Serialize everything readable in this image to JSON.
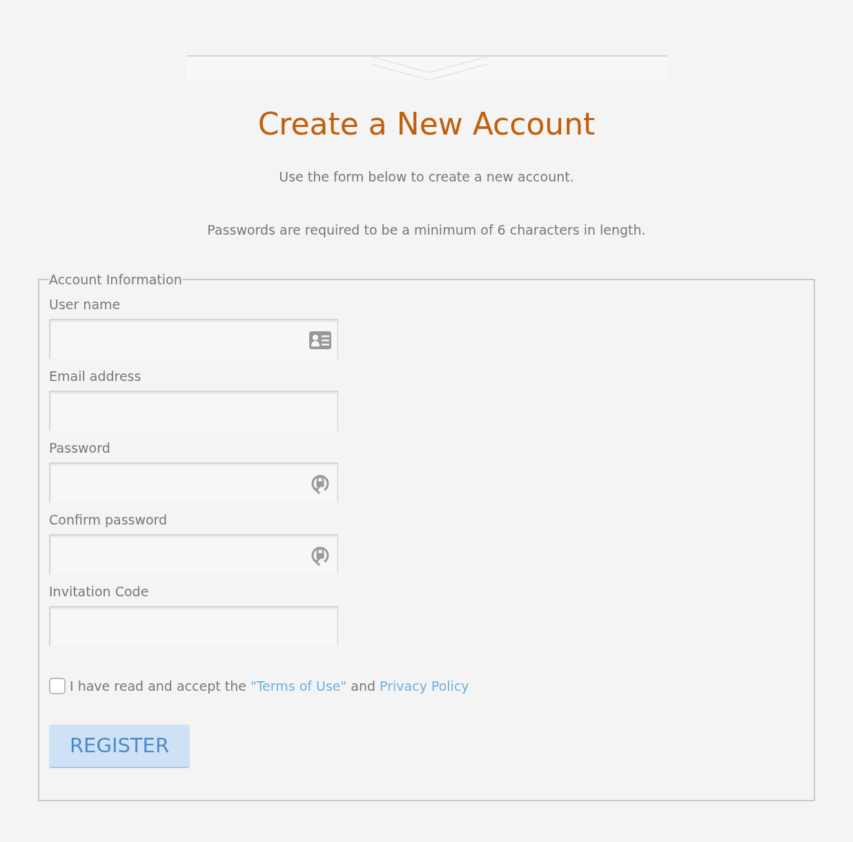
{
  "title": "Create a New Account",
  "intro": [
    "Use the form below to create a new account.",
    "Passwords are required to be a minimum of 6 characters in length."
  ],
  "fieldset": {
    "legend": "Account Information",
    "fields": [
      {
        "label": "User name",
        "kind": "identity"
      },
      {
        "label": "Email address",
        "kind": "plain"
      },
      {
        "label": "Password",
        "kind": "secret"
      },
      {
        "label": "Confirm password",
        "kind": "secret"
      },
      {
        "label": "Invitation Code",
        "kind": "plain"
      }
    ],
    "agreement": {
      "checked": false,
      "text_before": "I have read and accept the",
      "terms_link": "\"Terms of Use\"",
      "text_middle": "and",
      "privacy_link": "Privacy Policy"
    },
    "button": "REGISTER"
  }
}
